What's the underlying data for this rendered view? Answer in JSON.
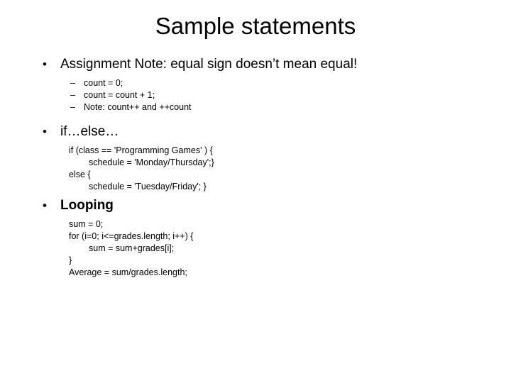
{
  "slide": {
    "title": "Sample statements",
    "bullet_glyph": "•",
    "dash_glyph": "–",
    "background_color": "#ffffff",
    "text_color": "#000000",
    "sections": [
      {
        "heading": "Assignment Note: equal sign doesn’t mean equal!",
        "sub_bullets": [
          "count = 0;",
          "count = count + 1;",
          "Note: count++   and ++count"
        ],
        "code": []
      },
      {
        "heading": "if…else…",
        "sub_bullets": [],
        "code": [
          {
            "text": "if (class == 'Programming Games' ) {",
            "indent": 0
          },
          {
            "text": "schedule = 'Monday/Thursday';}",
            "indent": 1
          },
          {
            "text": "else {",
            "indent": 0
          },
          {
            "text": "schedule = 'Tuesday/Friday'; }",
            "indent": 1
          }
        ]
      },
      {
        "heading": "Looping",
        "sub_bullets": [],
        "code": [
          {
            "text": "sum = 0;",
            "indent": 0
          },
          {
            "text": "for (i=0; i<=grades.length; i++) {",
            "indent": 0
          },
          {
            "text": "sum = sum+grades[i];",
            "indent": 1
          },
          {
            "text": "}",
            "indent": 0
          },
          {
            "text": "Average = sum/grades.length;",
            "indent": 0
          }
        ]
      }
    ]
  }
}
